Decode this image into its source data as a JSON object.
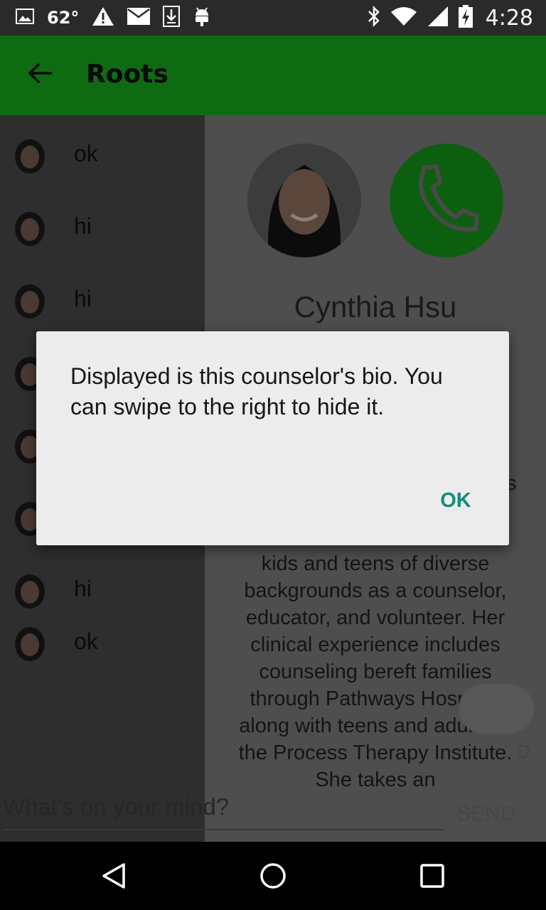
{
  "status_bar": {
    "temperature": "62°",
    "time": "4:28",
    "icons": [
      "gallery-icon",
      "alert-icon",
      "mail-icon",
      "download-icon",
      "android-icon",
      "bluetooth-icon",
      "wifi-icon",
      "signal-icon",
      "battery-charging-icon"
    ]
  },
  "app_bar": {
    "title": "Roots",
    "back_icon": "arrow-left-icon"
  },
  "messages": [
    {
      "text": "ok"
    },
    {
      "text": "hi"
    },
    {
      "text": "hi"
    },
    {
      "text": ""
    },
    {
      "text": ""
    },
    {
      "text": ""
    },
    {
      "text": "hi"
    },
    {
      "text": "ok"
    }
  ],
  "bio": {
    "name": "Cynthia Hsu",
    "text": "kids and teens of diverse backgrounds as a counselor, educator, and volunteer. Her clinical experience includes counseling bereft families through Pathways Hospice, along with teens and adults at the Process Therapy Institute. She takes an",
    "partial_letter": "s",
    "call_icon": "phone-icon"
  },
  "composer": {
    "placeholder": "What's on your mind?",
    "send_label": "SEND",
    "fab_label": "D"
  },
  "dialog": {
    "message": "Displayed is this counselor's bio. You can swipe to the right to hide it.",
    "ok_label": "OK"
  },
  "colors": {
    "app_bar": "#0f6b12",
    "accent_ok": "#128c7e",
    "call_button": "#0d5f10",
    "dialog_bg": "#ececec"
  }
}
